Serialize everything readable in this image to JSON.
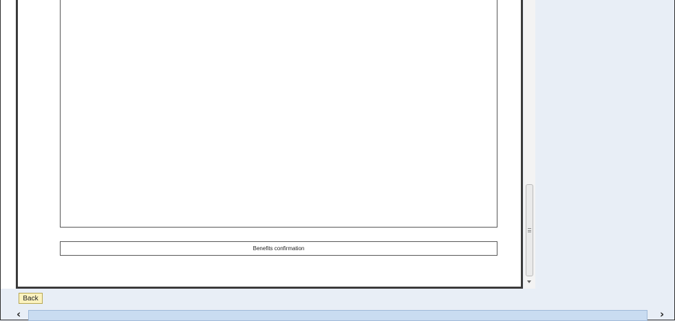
{
  "viewer": {
    "benefits_confirmation_label": "Benefits confirmation"
  },
  "footer": {
    "back_label": "Back"
  },
  "scrollbar": {
    "left_arrow": "‹",
    "right_arrow": "›"
  },
  "colors": {
    "page_background": "#e8eef6",
    "back_button_bg": "#fbf2bf",
    "h_scroll_track": "#c9dcf1"
  }
}
